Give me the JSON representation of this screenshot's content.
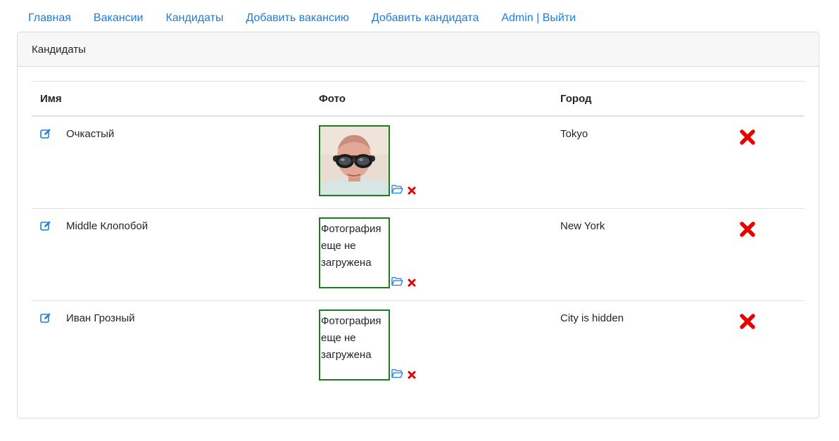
{
  "nav": {
    "items": [
      {
        "label": "Главная"
      },
      {
        "label": "Вакансии"
      },
      {
        "label": "Кандидаты"
      },
      {
        "label": "Добавить вакансию"
      },
      {
        "label": "Добавить кандидата"
      },
      {
        "label": "Admin | Выйти"
      }
    ]
  },
  "card": {
    "title": "Кандидаты",
    "columns": {
      "name": "Имя",
      "photo": "Фото",
      "city": "Город"
    },
    "rows": [
      {
        "name": "Очкастый",
        "city": "Tokyo",
        "photo_text": null,
        "has_photo": true
      },
      {
        "name": "Middle Клопобой",
        "city": "New York",
        "photo_text": "Фотография еще не загружена",
        "has_photo": false
      },
      {
        "name": "Иван Грозный",
        "city": "City is hidden",
        "photo_text": "Фотография еще не загружена",
        "has_photo": false
      }
    ]
  },
  "icons": {
    "edit": "edit-icon",
    "upload": "folder-open-icon",
    "delete_photo": "delete-photo-icon",
    "delete_candidate": "delete-candidate-icon"
  },
  "colors": {
    "link": "#1a7de6",
    "photo_border": "#1e7b1e",
    "delete": "#e60000"
  }
}
